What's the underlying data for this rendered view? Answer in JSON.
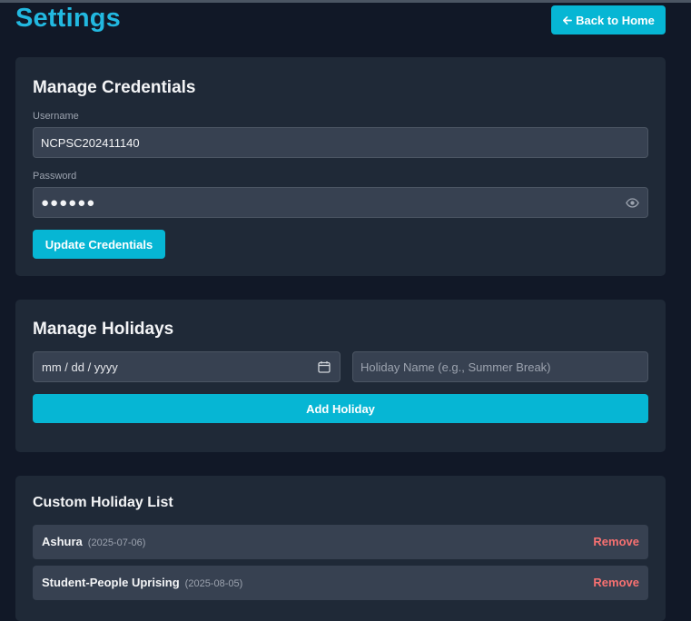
{
  "header": {
    "title": "Settings",
    "back_button": "Back to Home",
    "back_icon": "arrow-left-icon"
  },
  "credentials": {
    "title": "Manage Credentials",
    "username_label": "Username",
    "username_value": "NCPSC202411140",
    "password_label": "Password",
    "password_mask": "●●●●●●",
    "toggle_icon": "eye-icon",
    "update_button": "Update Credentials"
  },
  "holidays_form": {
    "title": "Manage Holidays",
    "date_placeholder": "mm / dd / yyyy",
    "calendar_icon": "calendar-icon",
    "name_placeholder": "Holiday Name (e.g., Summer Break)",
    "add_button": "Add Holiday"
  },
  "holiday_list": {
    "title": "Custom Holiday List",
    "remove_label": "Remove",
    "items": [
      {
        "name": "Ashura",
        "date": "(2025-07-06)"
      },
      {
        "name": "Student-People Uprising",
        "date": "(2025-08-05)"
      }
    ]
  },
  "colors": {
    "background": "#111827",
    "card": "#1f2937",
    "input": "#374151",
    "accent": "#06b6d4",
    "danger": "#f87171"
  }
}
